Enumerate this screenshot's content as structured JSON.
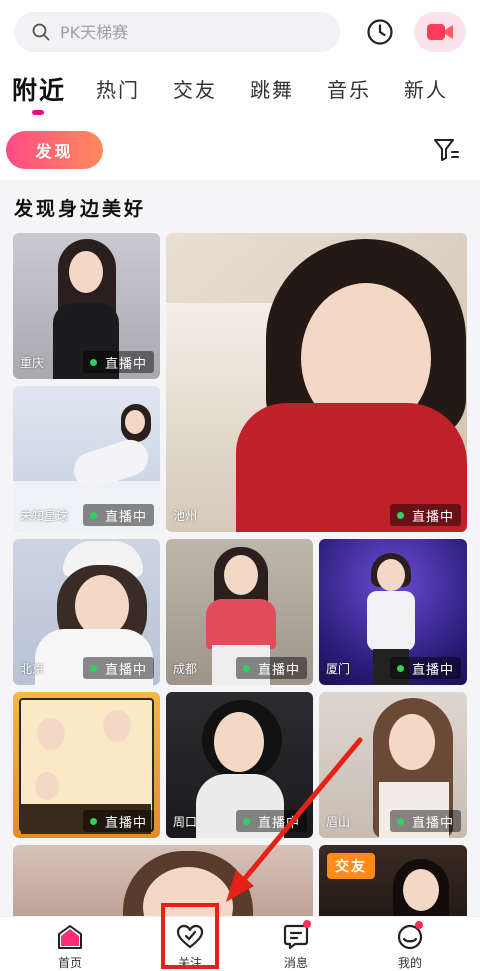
{
  "search": {
    "placeholder": "PK天梯赛",
    "icon": "search-icon"
  },
  "header_icons": {
    "history": "clock-icon",
    "live": "video-camera-icon"
  },
  "tabs": [
    {
      "label": "附近",
      "active": true
    },
    {
      "label": "热门"
    },
    {
      "label": "交友"
    },
    {
      "label": "跳舞"
    },
    {
      "label": "音乐"
    },
    {
      "label": "新人"
    }
  ],
  "discover_button": "发现",
  "filter_icon": "filter-icon",
  "section_title": "发现身边美好",
  "live_label": "直播中",
  "cards": [
    {
      "city": "重庆",
      "live": true
    },
    {
      "city": "未知星球",
      "live": true
    },
    {
      "city": "池州",
      "live": true
    },
    {
      "city": "北京",
      "live": true
    },
    {
      "city": "成都",
      "live": true
    },
    {
      "city": "厦门",
      "live": true
    },
    {
      "city": "",
      "live": true
    },
    {
      "city": "周口",
      "live": true
    },
    {
      "city": "眉山",
      "live": true
    },
    {
      "city": "",
      "live": false
    },
    {
      "city": "",
      "live": false,
      "tag": "交友"
    }
  ],
  "bottom_nav": [
    {
      "label": "首页",
      "icon": "home-icon"
    },
    {
      "label": "关注",
      "icon": "heart-icon"
    },
    {
      "label": "消息",
      "icon": "message-icon"
    },
    {
      "label": "我的",
      "icon": "profile-icon"
    }
  ],
  "colors": {
    "accent": "#e3127a",
    "live_dot": "#2dd35e",
    "annotation": "#e62117"
  }
}
